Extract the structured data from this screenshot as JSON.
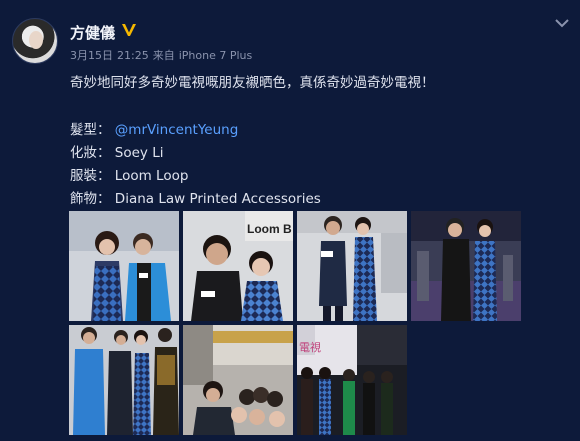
{
  "user": {
    "name": "方健儀",
    "date": "3月15日",
    "time": "21:25",
    "source_prefix": "来自",
    "source": "iPhone 7 Plus"
  },
  "post": {
    "main_text": "奇妙地同好多奇妙電視嘅朋友襯晒色，真係奇妙過奇妙電視！",
    "credits": [
      {
        "label": "髮型：",
        "value": "@mrVincentYeung",
        "is_link": true
      },
      {
        "label": "化妝：",
        "value": "Soey Li",
        "is_link": false
      },
      {
        "label": "服裝：",
        "value": "Loom Loop",
        "is_link": false
      },
      {
        "label": "飾物：",
        "value": "Diana Law Printed Accessories",
        "is_link": false
      }
    ]
  },
  "photos": {
    "photo3_sign_text": "Loom B",
    "photo8_sign_text": "電視"
  },
  "colors": {
    "background": "#0d1a3a",
    "link": "#5aa0ff",
    "verified": "#f5b800",
    "meta": "#8a93ad"
  },
  "icons": [
    "verified-badge-icon",
    "chevron-down-icon"
  ]
}
